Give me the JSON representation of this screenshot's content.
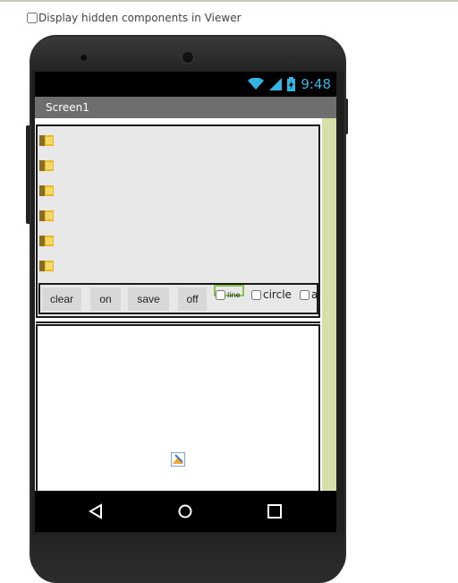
{
  "viewer": {
    "hidden_components_label": "Display hidden components in Viewer",
    "hidden_components_checked": false
  },
  "status_bar": {
    "time": "9:48",
    "accent_color": "#33b5e5"
  },
  "screen": {
    "title": "Screen1"
  },
  "image_rows": [
    {
      "icon": "image-placeholder-icon"
    },
    {
      "icon": "image-placeholder-icon"
    },
    {
      "icon": "image-placeholder-icon"
    },
    {
      "icon": "image-placeholder-icon"
    },
    {
      "icon": "image-placeholder-icon"
    },
    {
      "icon": "image-placeholder-icon"
    }
  ],
  "buttons": {
    "clear": "clear",
    "on": "on",
    "save": "save",
    "off": "off"
  },
  "checkboxes": {
    "line": "line",
    "circle": "circle",
    "arrow": "ar"
  },
  "colors": {
    "scrollbar": "#d6dfa8",
    "selection": "#8bc34a",
    "title_bar": "#6e6e6e"
  }
}
